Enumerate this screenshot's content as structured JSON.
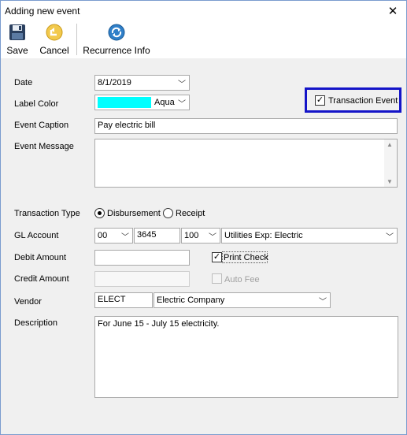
{
  "window": {
    "title": "Adding new event",
    "close_glyph": "✕"
  },
  "toolbar": {
    "save_label": "Save",
    "save_icon": "floppy-disk-icon",
    "cancel_label": "Cancel",
    "cancel_icon": "cancel-icon",
    "recurrence_label": "Recurrence Info",
    "recurrence_icon": "recurrence-icon"
  },
  "form": {
    "date_label": "Date",
    "date_value": "8/1/2019",
    "label_color_label": "Label Color",
    "label_color_value": "Aqua",
    "label_color_hex": "#00ffff",
    "transaction_event_label": "Transaction Event",
    "transaction_event_checked": true,
    "event_caption_label": "Event Caption",
    "event_caption_value": "Pay electric bill",
    "event_message_label": "Event Message",
    "event_message_value": "",
    "transaction_type_label": "Transaction Type",
    "transaction_type_options": [
      "Disbursement",
      "Receipt"
    ],
    "transaction_type_selected": "Disbursement",
    "gl_account_label": "GL Account",
    "gl_account_fund": "00",
    "gl_account_number": "3645",
    "gl_account_dept": "100",
    "gl_account_desc": "Utilities Exp: Electric",
    "debit_amount_label": "Debit Amount",
    "debit_amount_value": "",
    "print_check_label": "Print Check",
    "print_check_checked": true,
    "credit_amount_label": "Credit Amount",
    "credit_amount_value": "",
    "auto_fee_label": "Auto Fee",
    "auto_fee_checked": false,
    "vendor_label": "Vendor",
    "vendor_code": "ELECT",
    "vendor_name": "Electric Company",
    "description_label": "Description",
    "description_value": "For June 15 - July 15 electricity."
  },
  "colors": {
    "highlight_border": "#1414c8",
    "swatch": "#00ffff"
  }
}
